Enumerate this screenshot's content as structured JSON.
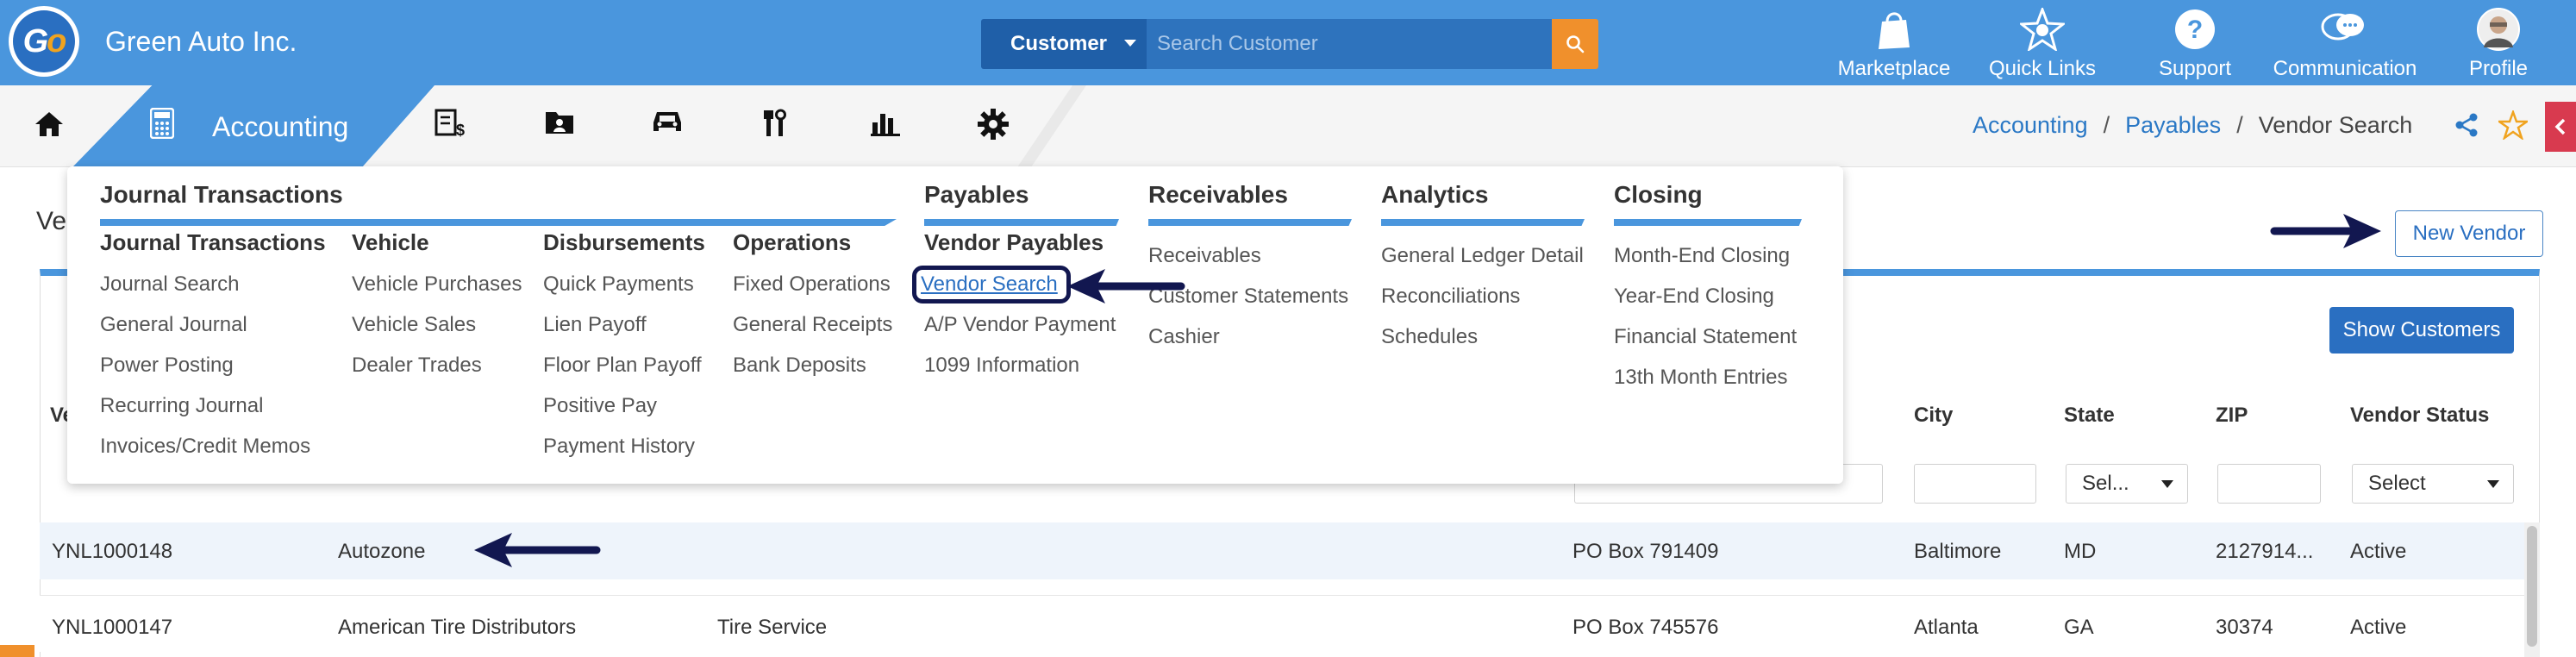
{
  "header": {
    "company": "Green Auto Inc.",
    "search": {
      "scope": "Customer",
      "placeholder": "Search Customer"
    },
    "icons": [
      {
        "label": "Marketplace"
      },
      {
        "label": "Quick Links"
      },
      {
        "label": "Support"
      },
      {
        "label": "Communication"
      },
      {
        "label": "Profile"
      }
    ]
  },
  "nav": {
    "active_label": "Accounting"
  },
  "breadcrumb": [
    "Accounting",
    "Payables",
    "Vendor Search"
  ],
  "page": {
    "title_visible": "Ve",
    "new_vendor": "New Vendor",
    "show_customers": "Show Customers",
    "columns": [
      "Ve",
      "City",
      "State",
      "ZIP",
      "Vendor Status"
    ],
    "filter_state": "Sel...",
    "filter_status": "Select",
    "rows": [
      {
        "id": "YNL1000148",
        "name": "Autozone",
        "type": "",
        "address": "PO Box 791409",
        "city": "Baltimore",
        "state": "MD",
        "zip": "2127914...",
        "status": "Active"
      },
      {
        "id": "YNL1000147",
        "name": "American Tire Distributors",
        "type": "Tire Service",
        "address": "PO Box 745576",
        "city": "Atlanta",
        "state": "GA",
        "zip": "30374",
        "status": "Active"
      }
    ]
  },
  "menu": {
    "sections": [
      {
        "title": "Journal Transactions"
      },
      {
        "title": "Payables"
      },
      {
        "title": "Receivables"
      },
      {
        "title": "Analytics"
      },
      {
        "title": "Closing"
      }
    ],
    "groups": [
      {
        "title": "Journal Transactions",
        "items": [
          "Journal Search",
          "General Journal",
          "Power Posting",
          "Recurring Journal",
          "Invoices/Credit Memos"
        ]
      },
      {
        "title": "Vehicle",
        "items": [
          "Vehicle Purchases",
          "Vehicle Sales",
          "Dealer Trades"
        ]
      },
      {
        "title": "Disbursements",
        "items": [
          "Quick Payments",
          "Lien Payoff",
          "Floor Plan Payoff",
          "Positive Pay",
          "Payment History"
        ]
      },
      {
        "title": "Operations",
        "items": [
          "Fixed Operations",
          "General Receipts",
          "Bank Deposits"
        ]
      },
      {
        "title": "Vendor Payables",
        "items": [
          "Vendor Search",
          "A/P Vendor Payment",
          "1099 Information"
        ]
      },
      {
        "title": "",
        "items": [
          "Receivables",
          "Customer Statements",
          "Cashier"
        ]
      },
      {
        "title": "",
        "items": [
          "General Ledger Detail",
          "Reconciliations",
          "Schedules"
        ]
      },
      {
        "title": "",
        "items": [
          "Month-End Closing",
          "Year-End Closing",
          "Financial Statement",
          "13th Month Entries"
        ]
      }
    ]
  },
  "colors": {
    "header_blue": "#4a96dd",
    "accent_orange": "#f0902c",
    "annotation_arrow": "#121750"
  }
}
